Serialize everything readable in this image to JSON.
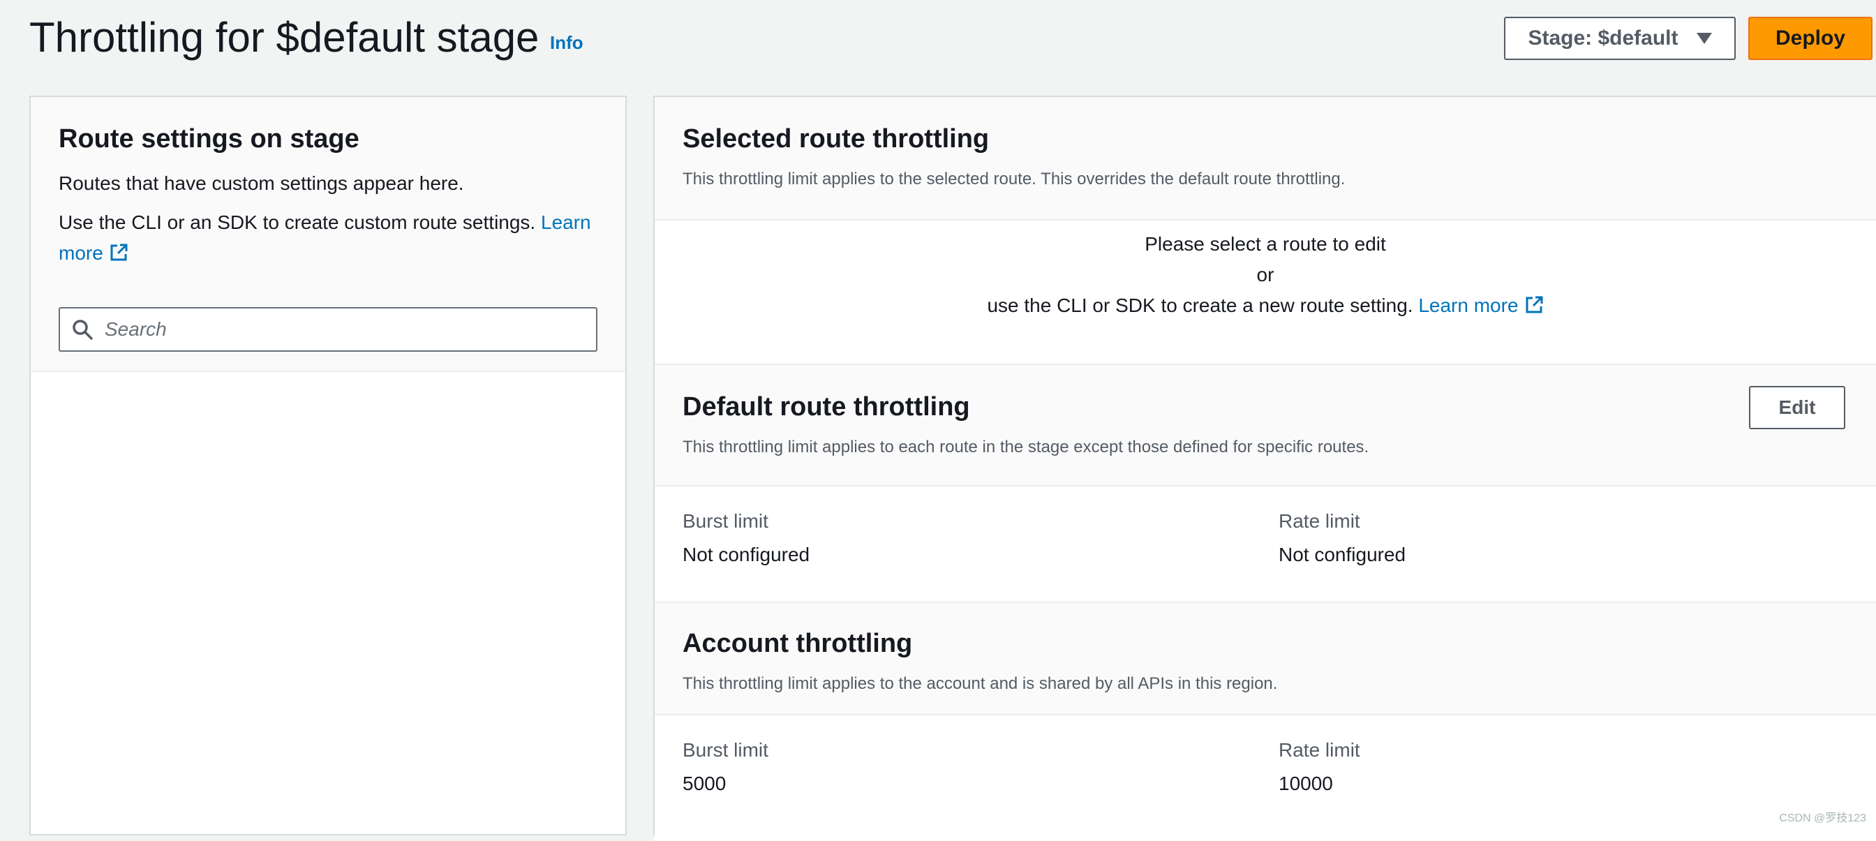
{
  "header": {
    "title": "Throttling for $default stage",
    "info": "Info",
    "stage_select": "Stage: $default",
    "deploy": "Deploy"
  },
  "left": {
    "title": "Route settings on stage",
    "text1": "Routes that have custom settings appear here.",
    "text2": "Use the CLI or an SDK to create custom route settings.",
    "learn_more": "Learn more",
    "search_placeholder": "Search"
  },
  "selected_route": {
    "title": "Selected route throttling",
    "desc": "This throttling limit applies to the selected route. This overrides the default route throttling.",
    "line1": "Please select a route to edit",
    "line2": "or",
    "line3": "use the CLI or SDK to create a new route setting.",
    "learn_more": "Learn more"
  },
  "default_route": {
    "title": "Default route throttling",
    "desc": "This throttling limit applies to each route in the stage except those defined for specific routes.",
    "edit": "Edit",
    "burst_label": "Burst limit",
    "burst_value": "Not configured",
    "rate_label": "Rate limit",
    "rate_value": "Not configured"
  },
  "account": {
    "title": "Account throttling",
    "desc": "This throttling limit applies to the account and is shared by all APIs in this region.",
    "burst_label": "Burst limit",
    "burst_value": "5000",
    "rate_label": "Rate limit",
    "rate_value": "10000"
  },
  "watermark": "CSDN @罗技123",
  "colors": {
    "accent": "#ff9900",
    "link": "#0073bb",
    "background": "#f2f3f3"
  }
}
